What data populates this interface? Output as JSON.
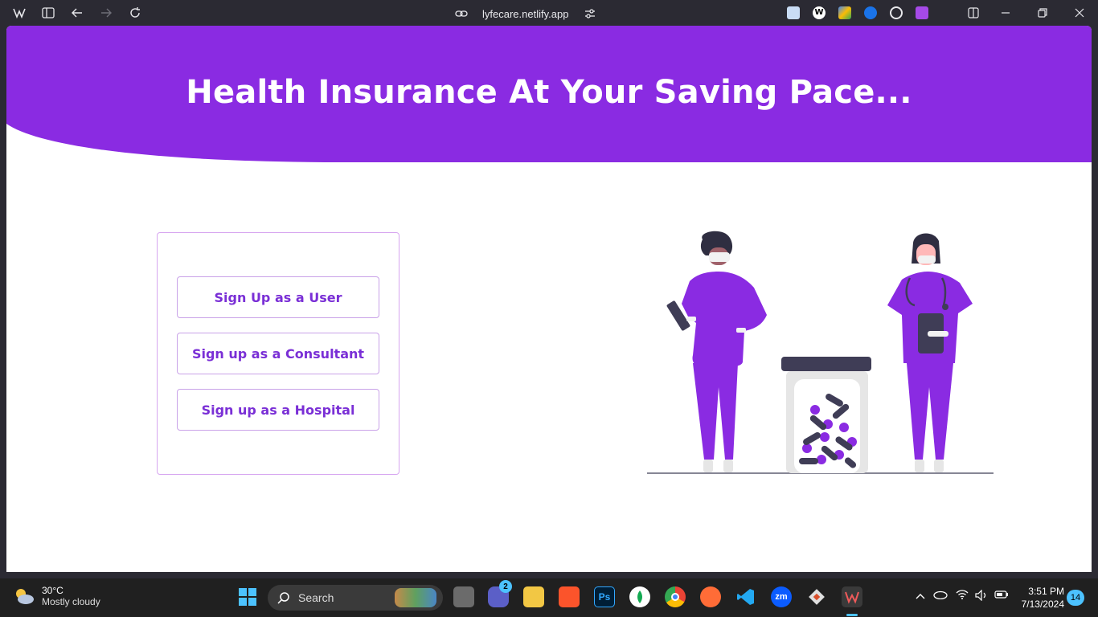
{
  "browser": {
    "url": "lyfecare.netlify.app"
  },
  "hero": {
    "title": "Health Insurance At Your Saving Pace...",
    "color": "#8a2be2"
  },
  "signup": {
    "user_label": "Sign Up as a User",
    "consultant_label": "Sign up as a Consultant",
    "hospital_label": "Sign up as a Hospital"
  },
  "taskbar": {
    "weather_temp": "30°C",
    "weather_desc": "Mostly cloudy",
    "search_placeholder": "Search",
    "teams_badge": "2",
    "time": "3:51 PM",
    "date": "7/13/2024",
    "notification_count": "14"
  }
}
